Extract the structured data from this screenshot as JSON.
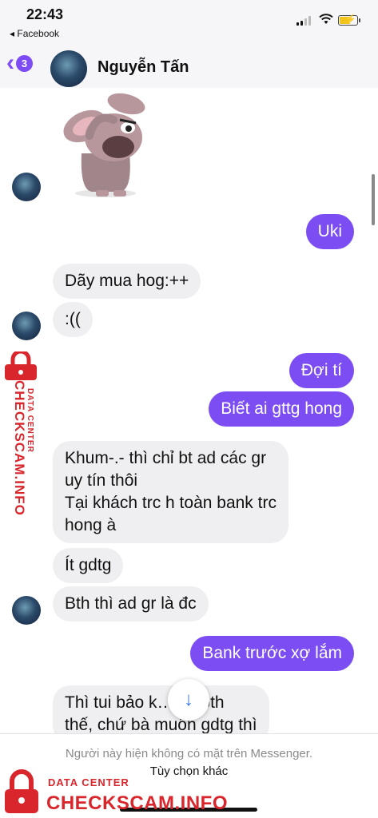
{
  "status_bar": {
    "time": "22:43",
    "back_app": "◂ Facebook"
  },
  "header": {
    "unread_count": "3",
    "contact_name": "Nguyễn Tấn"
  },
  "messages": [
    {
      "side": "out",
      "text": "Uki"
    },
    {
      "side": "in",
      "text": "Dãy mua hog:++"
    },
    {
      "side": "in",
      "text": ":(("
    },
    {
      "side": "out",
      "text": "Đợi tí"
    },
    {
      "side": "out",
      "text": "Biết ai gttg hong"
    },
    {
      "side": "in",
      "text": "Khum-.- thì chỉ bt ad các gr\nuy tín thôi\nTại khách trc h toàn bank trc\nhong à"
    },
    {
      "side": "in",
      "text": "Ít gdtg"
    },
    {
      "side": "in",
      "text": "Bth thì ad gr là đc"
    },
    {
      "side": "out",
      "text": "Bank trước xợ lắm"
    },
    {
      "side": "in",
      "text": "Thì tui bảo k… tui bth\nthế, chứ bà muốn gdtg thì"
    }
  ],
  "footer": {
    "notice": "Người này hiện không có mặt trên Messenger.",
    "options": "Tùy chọn khác"
  },
  "watermark": {
    "small": "DATA CENTER",
    "big": "CHECKSCAM.INFO"
  },
  "colors": {
    "accent": "#7b4df2",
    "incoming_bubble": "#efeff1",
    "watermark": "#d9262c"
  },
  "icons": [
    "back-chevron-icon",
    "signal-icon",
    "wifi-icon",
    "battery-icon",
    "scroll-down-arrow-icon",
    "lock-icon"
  ]
}
